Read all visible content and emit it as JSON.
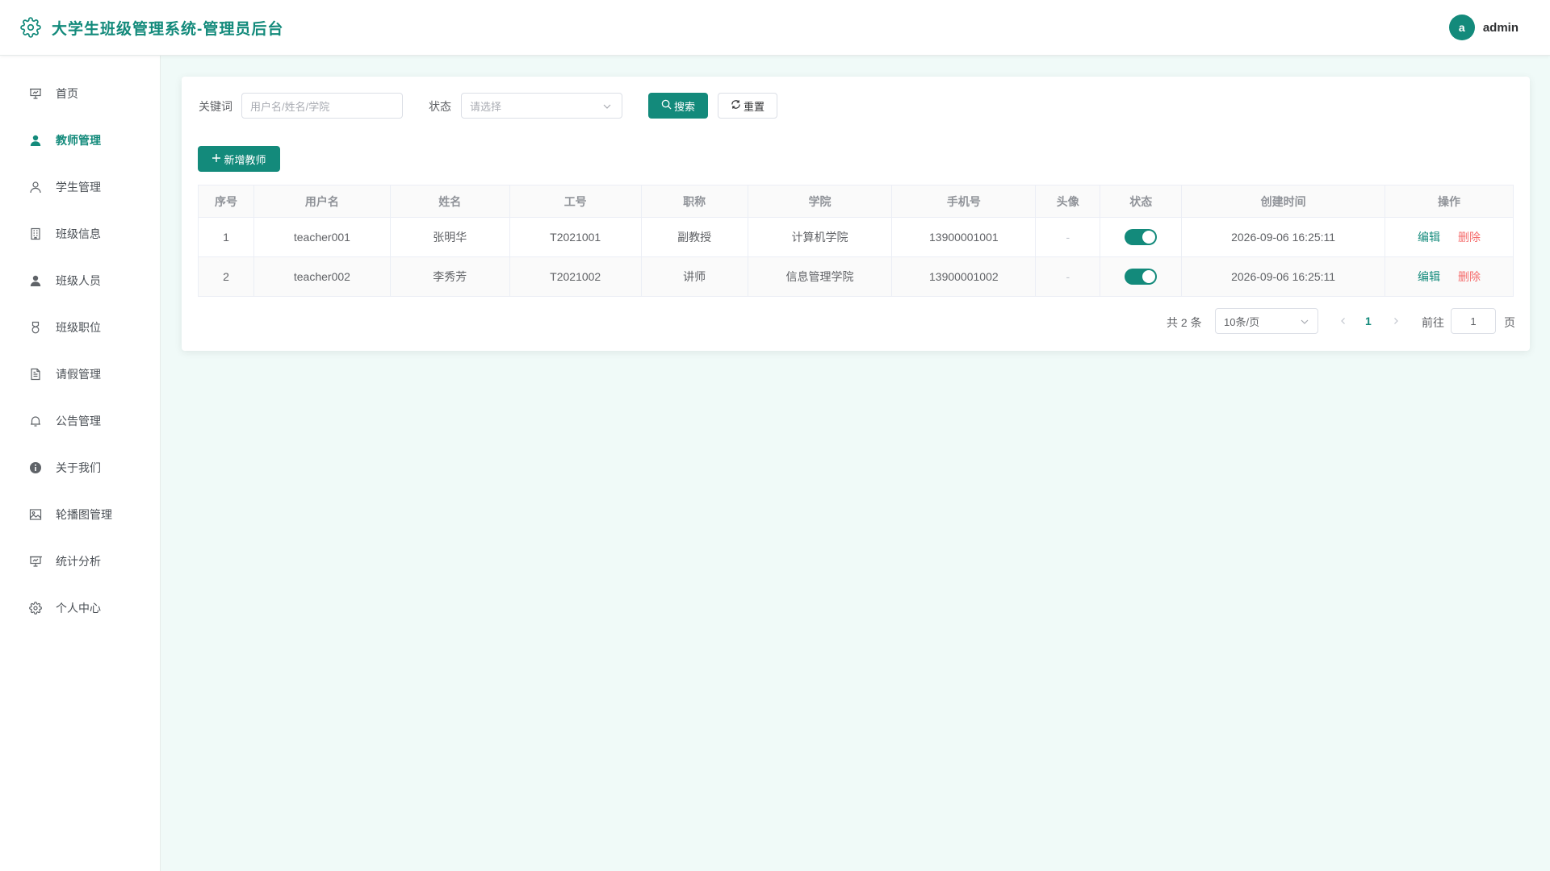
{
  "header": {
    "title": "大学生班级管理系统-管理员后台",
    "avatar_letter": "a",
    "username": "admin"
  },
  "sidebar": {
    "items": [
      {
        "label": "首页",
        "icon": "presentation-icon",
        "active": false
      },
      {
        "label": "教师管理",
        "icon": "user-filled-icon",
        "active": true
      },
      {
        "label": "学生管理",
        "icon": "user-outline-icon",
        "active": false
      },
      {
        "label": "班级信息",
        "icon": "building-icon",
        "active": false
      },
      {
        "label": "班级人员",
        "icon": "user-filled-icon",
        "active": false
      },
      {
        "label": "班级职位",
        "icon": "medal-icon",
        "active": false
      },
      {
        "label": "请假管理",
        "icon": "document-icon",
        "active": false
      },
      {
        "label": "公告管理",
        "icon": "bell-icon",
        "active": false
      },
      {
        "label": "关于我们",
        "icon": "info-icon",
        "active": false
      },
      {
        "label": "轮播图管理",
        "icon": "picture-icon",
        "active": false
      },
      {
        "label": "统计分析",
        "icon": "presentation-icon",
        "active": false
      },
      {
        "label": "个人中心",
        "icon": "gear-icon",
        "active": false
      }
    ]
  },
  "search": {
    "keyword_label": "关键词",
    "keyword_placeholder": "用户名/姓名/学院",
    "status_label": "状态",
    "status_placeholder": "请选择",
    "search_button": "搜索",
    "reset_button": "重置"
  },
  "add_button": "新增教师",
  "table": {
    "headers": [
      "序号",
      "用户名",
      "姓名",
      "工号",
      "职称",
      "学院",
      "手机号",
      "头像",
      "状态",
      "创建时间",
      "操作"
    ],
    "rows": [
      {
        "index": "1",
        "username": "teacher001",
        "name": "张明华",
        "job_no": "T2021001",
        "title": "副教授",
        "college": "计算机学院",
        "phone": "13900001001",
        "avatar": "-",
        "status_on": true,
        "created": "2026-09-06 16:25:11",
        "edit": "编辑",
        "delete": "删除"
      },
      {
        "index": "2",
        "username": "teacher002",
        "name": "李秀芳",
        "job_no": "T2021002",
        "title": "讲师",
        "college": "信息管理学院",
        "phone": "13900001002",
        "avatar": "-",
        "status_on": true,
        "created": "2026-09-06 16:25:11",
        "edit": "编辑",
        "delete": "删除"
      }
    ]
  },
  "pagination": {
    "total_text": "共 2 条",
    "page_size": "10条/页",
    "current_page": "1",
    "goto_label": "前往",
    "goto_value": "1",
    "page_suffix": "页"
  },
  "colors": {
    "primary": "#138a7b",
    "danger": "#f56c6c",
    "background": "#f0faf8"
  }
}
